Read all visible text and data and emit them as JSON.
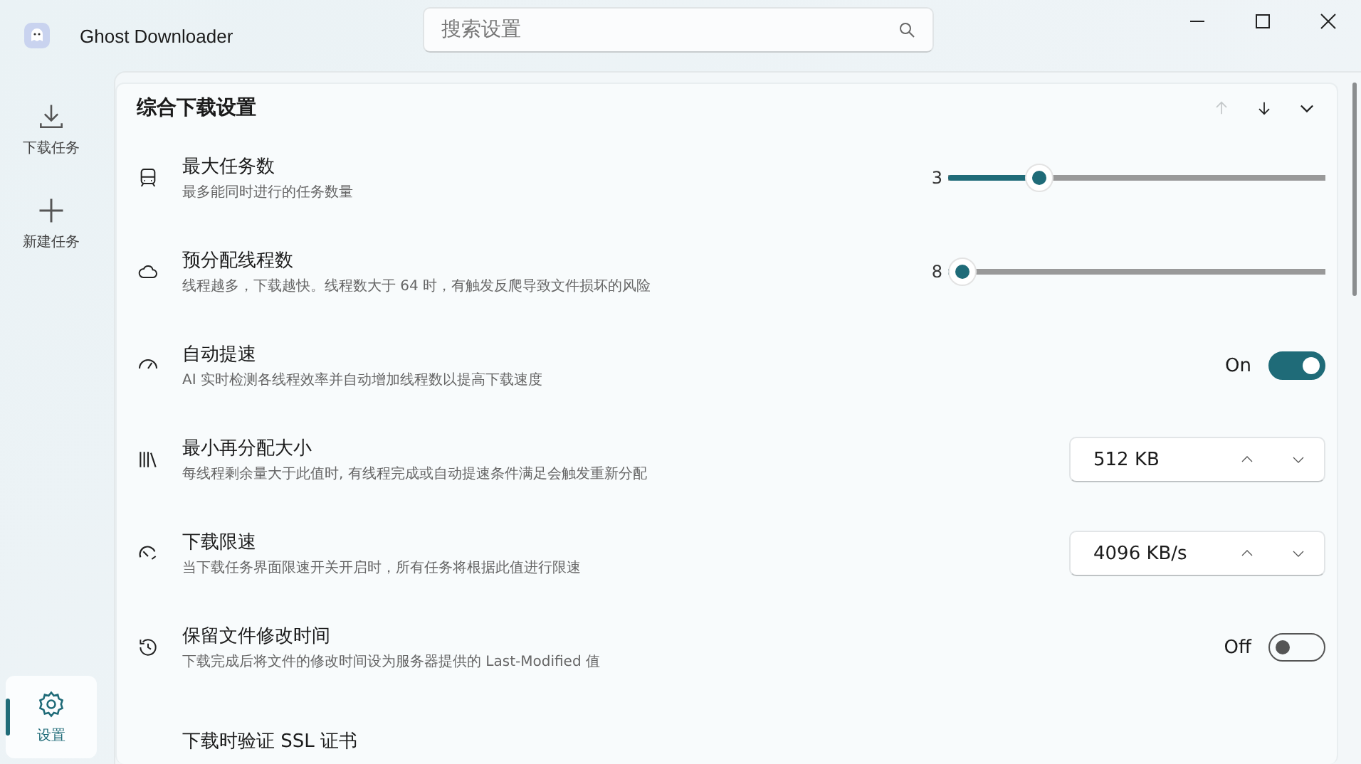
{
  "window": {
    "title": "Ghost Downloader"
  },
  "search": {
    "placeholder": "搜索设置"
  },
  "sidebar": {
    "items": [
      {
        "label": "下载任务",
        "selected": false
      },
      {
        "label": "新建任务",
        "selected": false
      }
    ],
    "bottom_items": [
      {
        "label": "设置",
        "selected": true
      }
    ]
  },
  "section": {
    "title": "综合下载设置",
    "nav": [
      {
        "kind": "up",
        "disabled": true
      },
      {
        "kind": "down",
        "disabled": false
      },
      {
        "kind": "collapse",
        "disabled": false
      }
    ]
  },
  "settings": [
    {
      "title": "最大任务数",
      "description": "最多能同时进行的任务数量",
      "kind": "slider",
      "value": "3",
      "level": 0.22
    },
    {
      "title": "预分配线程数",
      "description": "线程越多，下载越快。线程数大于 64 时，有触发反爬导致文件损坏的风险",
      "kind": "slider",
      "value": "8",
      "level": 0
    },
    {
      "title": "自动提速",
      "description": "AI 实时检测各线程效率并自动增加线程数以提高下载速度",
      "kind": "toggle",
      "state_label": "On",
      "on": true
    },
    {
      "title": "最小再分配大小",
      "description": "每线程剩余量大于此值时, 有线程完成或自动提速条件满足会触发重新分配",
      "kind": "spinbox",
      "value": "512 KB"
    },
    {
      "title": "下载限速",
      "description": "当下载任务界面限速开关开启时，所有任务将根据此值进行限速",
      "kind": "spinbox",
      "value": "4096 KB/s"
    },
    {
      "title": "保留文件修改时间",
      "description": "下载完成后将文件的修改时间设为服务器提供的 Last-Modified 值",
      "kind": "toggle",
      "state_label": "Off",
      "on": false
    },
    {
      "title": "下载时验证 SSL 证书",
      "kind": "none"
    }
  ]
}
